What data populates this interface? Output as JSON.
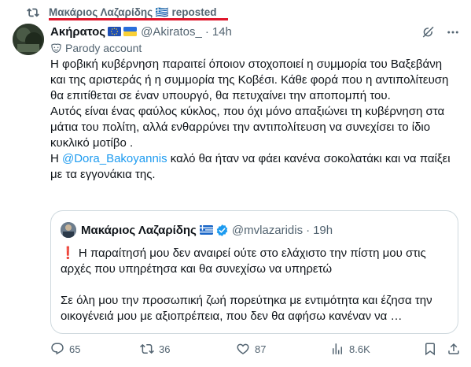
{
  "repost": {
    "label": "Μακάριος Λαζαρίδης 🇬🇷 reposted"
  },
  "tweet": {
    "display_name": "Ακήρατος",
    "handle": "@Akiratos_",
    "separator": "·",
    "time": "14h",
    "parody_label": "Parody account",
    "paragraphs": [
      "Η φοβική κυβέρνηση παραιτεί όποιον στοχοποιεί η συμμορία του Βαξεβάνη και της αριστεράς ή η συμμορία της Κοβέσι. Κάθε φορά που η αντιπολίτευση θα επιτίθεται σε έναν υπουργό, θα πετυχαίνει την αποπομπή του.",
      "Αυτός είναι ένας φαύλος κύκλος, που όχι μόνο απαξιώνει τη κυβέρνηση στα μάτια του πολίτη, αλλά ενθαρρύνει την αντιπολίτευση να συνεχίσει το ίδιο κυκλικό μοτίβο ."
    ],
    "last_paragraph": {
      "prefix": "Η ",
      "mention": "@Dora_Bakoyannis",
      "suffix": " καλό θα ήταν να φάει κανένα σοκολατάκι και να παίξει με τα εγγονάκια της."
    }
  },
  "quote": {
    "display_name": "Μακάριος Λαζαρίδης",
    "handle": "@mvlazaridis",
    "separator": "·",
    "time": "19h",
    "paragraph_1": "❗ Η παραίτησή μου δεν αναιρεί ούτε στο ελάχιστο την πίστη μου στις αρχές που υπηρέτησα και θα συνεχίσω να υπηρετώ",
    "paragraph_2": "Σε όλη μου την προσωπική ζωή πορεύτηκα με εντιμότητα και έζησα την οικογένειά μου με αξιοπρέπεια, που δεν θα αφήσω κανέναν να …"
  },
  "actions": {
    "replies": "65",
    "reposts": "36",
    "likes": "87",
    "views": "8.6K"
  },
  "icons": {
    "repost": "repost-icon",
    "parody": "parody-mask-icon",
    "grok": "grok-icon",
    "more": "more-icon",
    "verified": "verified-badge-icon",
    "reply": "reply-icon",
    "retweet": "retweet-icon",
    "like": "heart-icon",
    "views": "views-icon",
    "bookmark": "bookmark-icon",
    "share": "share-icon"
  },
  "colors": {
    "text": "#0f1419",
    "secondary": "#536471",
    "link": "#1d9bf0",
    "verified": "#1d9bf0",
    "border": "#cfd9de",
    "annotation_red": "#e0162b"
  }
}
